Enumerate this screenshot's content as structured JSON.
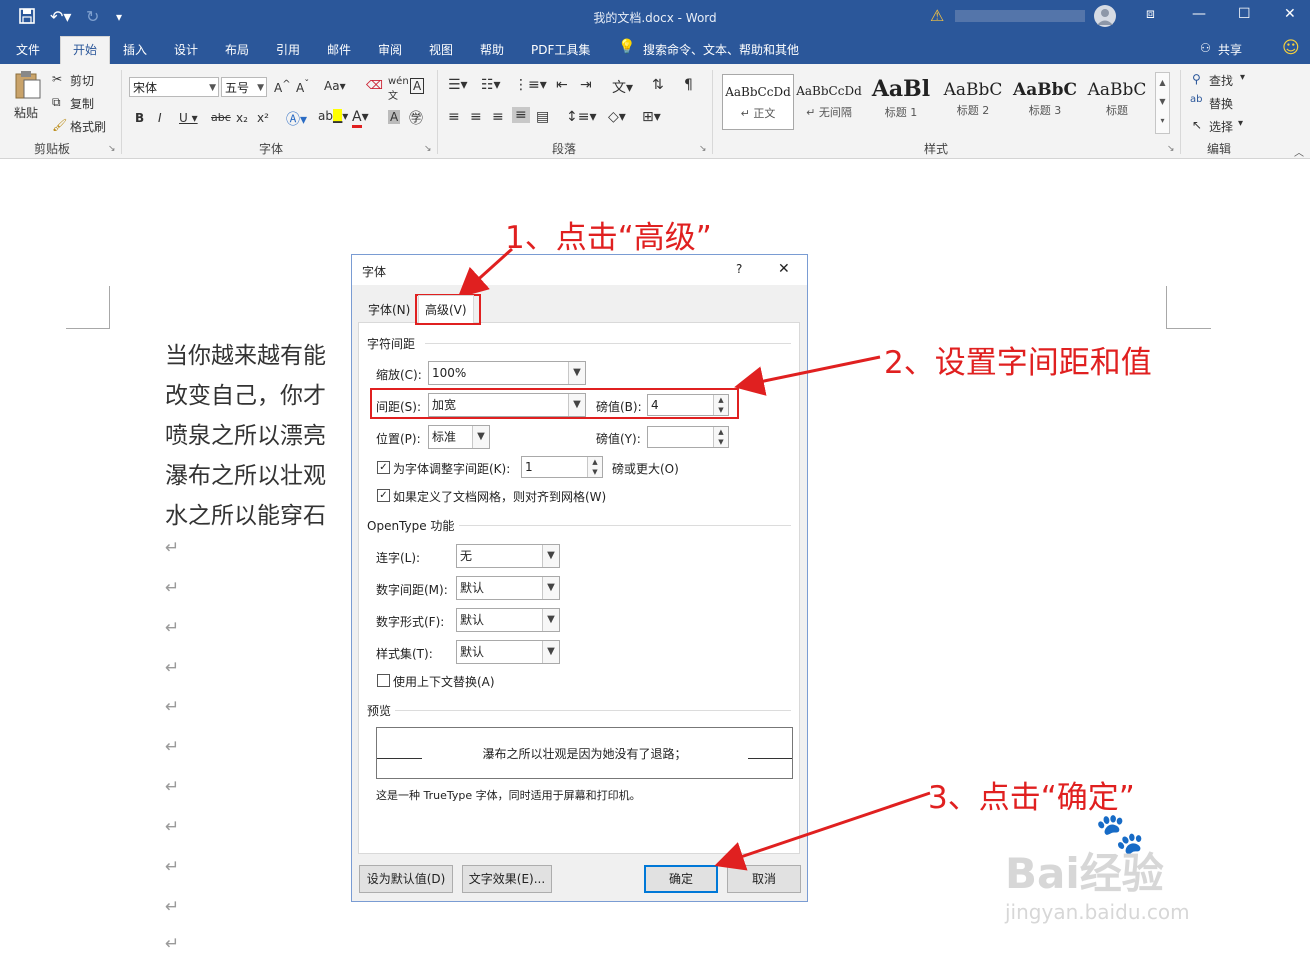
{
  "titlebar": {
    "doc_title": "我的文档.docx - Word",
    "warning_icon": "warning-icon",
    "min": "—",
    "max": "☐",
    "close": "✕"
  },
  "tabs": [
    "文件",
    "开始",
    "插入",
    "设计",
    "布局",
    "引用",
    "邮件",
    "审阅",
    "视图",
    "帮助",
    "PDF工具集"
  ],
  "active_tab": "开始",
  "tell_me": "搜索命令、文本、帮助和其他",
  "share": "共享",
  "ribbon": {
    "clipboard": {
      "paste": "粘贴",
      "cut": "剪切",
      "copy": "复制",
      "format_painter": "格式刷",
      "label": "剪贴板"
    },
    "font": {
      "name": "宋体",
      "size": "五号",
      "label": "字体"
    },
    "paragraph": {
      "label": "段落"
    },
    "styles": {
      "label": "样式",
      "items": [
        {
          "sample": "AaBbCcDd",
          "name": "↵ 正文"
        },
        {
          "sample": "AaBbCcDd",
          "name": "↵ 无间隔"
        },
        {
          "sample": "AaBl",
          "name": "标题 1"
        },
        {
          "sample": "AaBbC",
          "name": "标题 2"
        },
        {
          "sample": "AaBbC",
          "name": "标题 3"
        },
        {
          "sample": "AaBbC",
          "name": "标题"
        }
      ]
    },
    "editing": {
      "find": "查找",
      "replace": "替换",
      "select": "选择",
      "label": "编辑"
    }
  },
  "document": {
    "lines": [
      "当你越来越有能",
      "改变自己，你才",
      "喷泉之所以漂亮",
      "瀑布之所以壮观",
      "水之所以能穿石"
    ],
    "para_mark": "↵"
  },
  "dialog": {
    "title": "字体",
    "help": "?",
    "close": "✕",
    "tabs": [
      "字体(N)",
      "高级(V)"
    ],
    "char_spacing": {
      "section": "字符间距",
      "scale_label": "缩放(C):",
      "scale_value": "100%",
      "spacing_label": "间距(S):",
      "spacing_value": "加宽",
      "spacing_by_label": "磅值(B):",
      "spacing_by_value": "4",
      "position_label": "位置(P):",
      "position_value": "标准",
      "position_by_label": "磅值(Y):",
      "position_by_value": "",
      "kerning_label": "为字体调整字间距(K):",
      "kerning_value": "1",
      "kerning_suffix": "磅或更大(O)",
      "grid_label": "如果定义了文档网格，则对齐到网格(W)"
    },
    "opentype": {
      "section": "OpenType 功能",
      "ligatures_label": "连字(L):",
      "ligatures_value": "无",
      "num_spacing_label": "数字间距(M):",
      "num_spacing_value": "默认",
      "num_forms_label": "数字形式(F):",
      "num_forms_value": "默认",
      "stylistic_label": "样式集(T):",
      "stylistic_value": "默认",
      "contextual_label": "使用上下文替换(A)"
    },
    "preview": {
      "section": "预览",
      "text": "瀑布之所以壮观是因为她没有了退路；",
      "note": "这是一种 TrueType 字体，同时适用于屏幕和打印机。"
    },
    "buttons": {
      "set_default": "设为默认值(D)",
      "text_effects": "文字效果(E)...",
      "ok": "确定",
      "cancel": "取消"
    }
  },
  "annotations": {
    "step1": "1、点击“高级”",
    "step2": "2、设置字间距和值",
    "step3": "3、点击“确定”"
  },
  "watermark": {
    "brand": "Bai经验",
    "url": "jingyan.baidu.com"
  },
  "colors": {
    "word_blue": "#2b579a",
    "annotation_red": "#e02020",
    "ok_border": "#0078d7"
  }
}
